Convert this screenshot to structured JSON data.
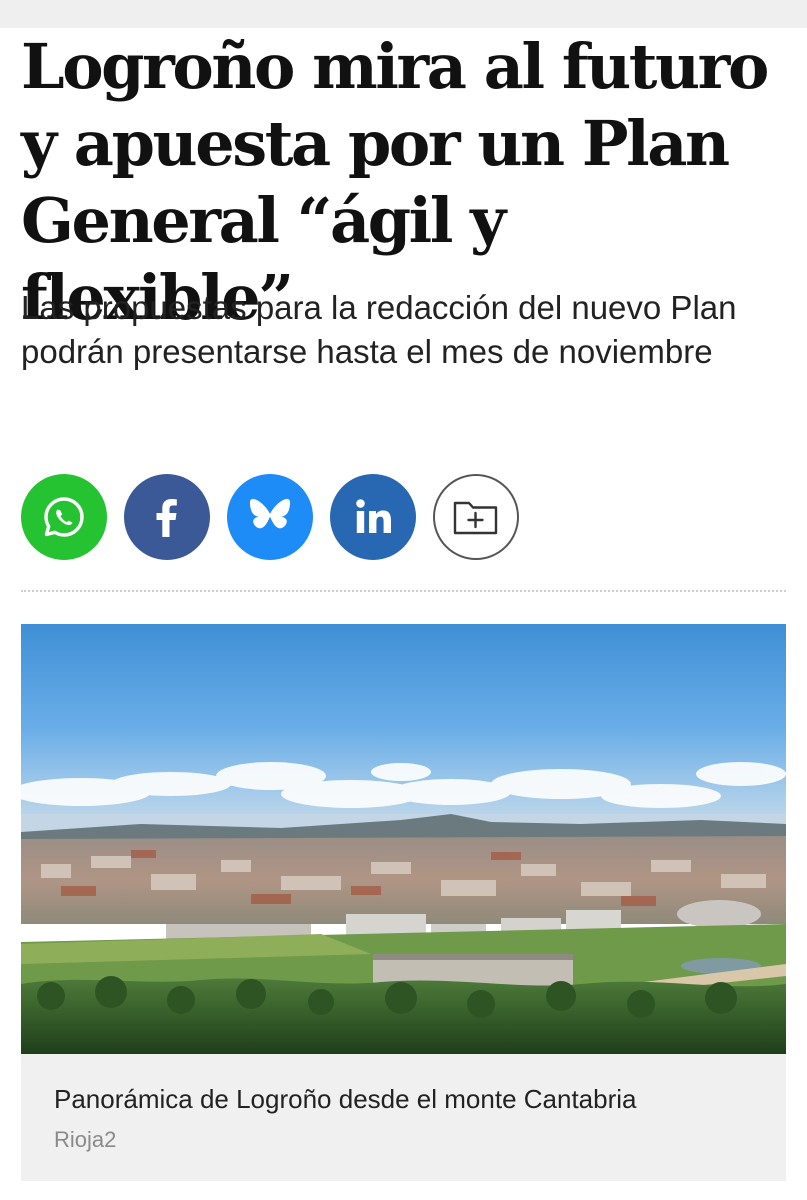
{
  "article": {
    "headline": "Logroño mira al futuro y apuesta por un Plan General “ágil y flexible”",
    "subheadline": "Las propuestas para la redacción del nuevo Plan podrán presentarse hasta el mes de noviembre"
  },
  "share": {
    "buttons": [
      {
        "id": "whatsapp",
        "icon": "whatsapp-icon",
        "color": "#25c231"
      },
      {
        "id": "facebook",
        "icon": "facebook-icon",
        "color": "#3b5897"
      },
      {
        "id": "bluesky",
        "icon": "bluesky-butterfly-icon",
        "color": "#1d8cf7"
      },
      {
        "id": "linkedin",
        "icon": "linkedin-icon",
        "color": "#2867b2"
      },
      {
        "id": "save",
        "icon": "folder-plus-icon",
        "color": "#ffffff"
      }
    ]
  },
  "figure": {
    "image_subject": "aerial panorama of a city with hills and blue sky",
    "caption": "Panorámica de Logroño desde el monte Cantabria",
    "credit": "Rioja2"
  }
}
